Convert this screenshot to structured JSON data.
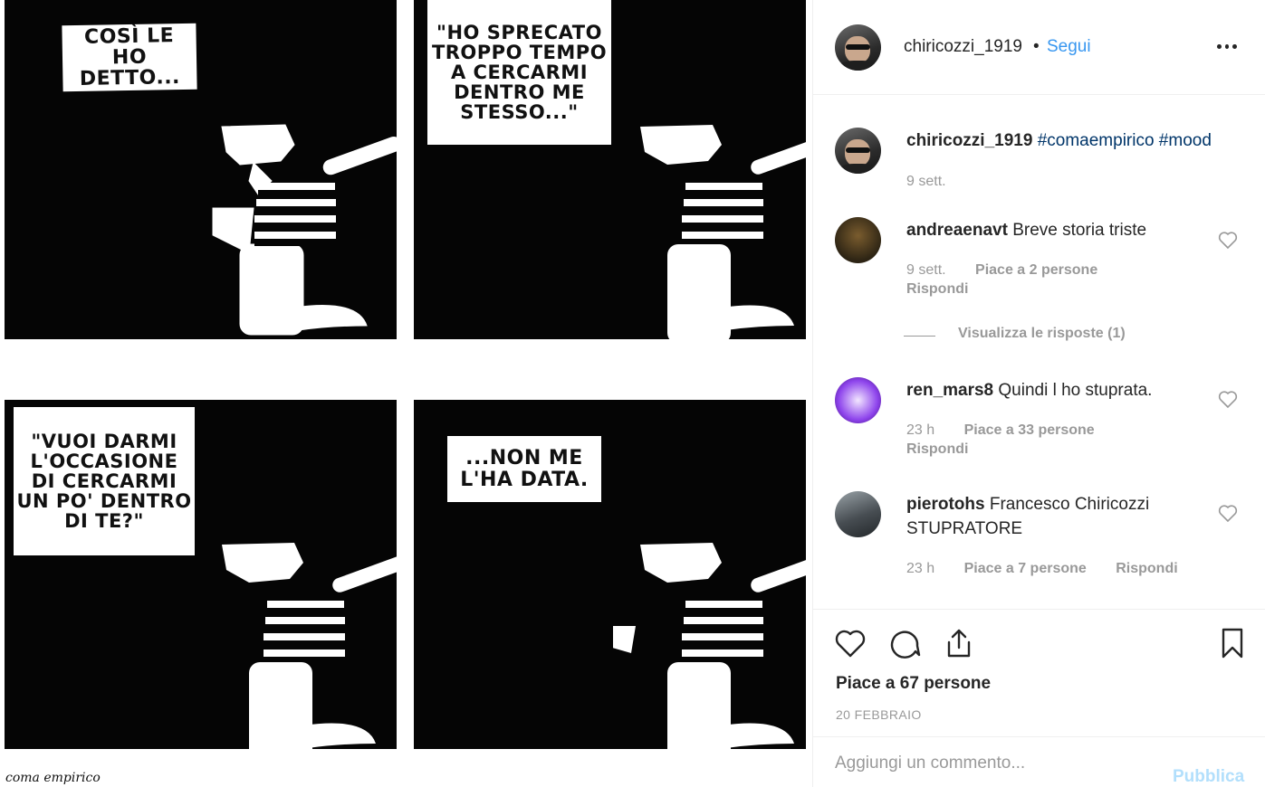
{
  "media": {
    "panels": [
      {
        "speech": "COSÌ LE\nHO DETTO..."
      },
      {
        "speech": "\"HO SPRECATO\nTROPPO TEMPO\nA CERCARMI\nDENTRO ME\nSTESSO...\""
      },
      {
        "speech": "\"VUOI DARMI\nL'OCCASIONE\nDI CERCARMI\nUN PO' DENTRO\nDI TE?\""
      },
      {
        "speech": "...NON ME\nL'HA DATA."
      }
    ],
    "signature": "coma empirico"
  },
  "header": {
    "username": "chiricozzi_1919",
    "separator": "•",
    "follow_label": "Segui",
    "more_icon": "more-horizontal-icon"
  },
  "caption": {
    "username": "chiricozzi_1919",
    "hashtags": "#comaempirico #mood",
    "time": "9 sett."
  },
  "comments": [
    {
      "username": "andreaenavt",
      "text": "Breve storia triste",
      "time": "9 sett.",
      "likes": "Piace a 2 persone",
      "reply_label": "Rispondi",
      "view_replies": "Visualizza le risposte (1)"
    },
    {
      "username": "ren_mars8",
      "text": "Quindi l ho stuprata.",
      "time": "23 h",
      "likes": "Piace a 33 persone",
      "reply_label": "Rispondi"
    },
    {
      "username": "pierotohs",
      "text": "Francesco Chiricozzi STUPRATORE",
      "time": "23 h",
      "likes": "Piace a 7 persone",
      "reply_label": "Rispondi"
    }
  ],
  "actions": {
    "like_icon": "heart-icon",
    "comment_icon": "comment-icon",
    "share_icon": "share-icon",
    "save_icon": "bookmark-icon",
    "likes_text": "Piace a 67 persone",
    "date": "20 FEBBRAIO"
  },
  "add_comment": {
    "placeholder": "Aggiungi un commento...",
    "publish_label": "Pubblica"
  },
  "colors": {
    "link_blue": "#3897f0",
    "hashtag": "#003569",
    "muted": "#999999",
    "publish_disabled": "#b2dffc"
  }
}
